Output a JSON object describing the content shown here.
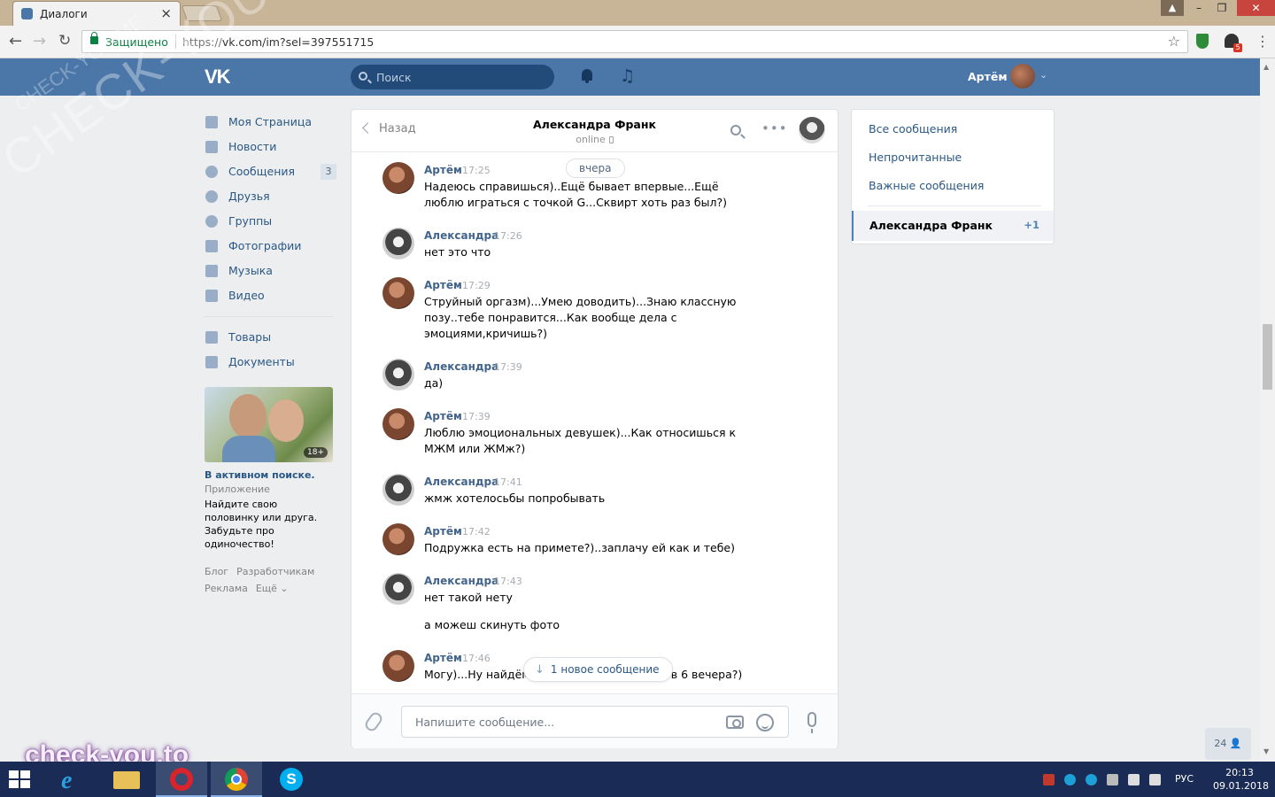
{
  "browser": {
    "tab_title": "Диалоги",
    "tab_close": "×",
    "secure_label": "Защищено",
    "url_scheme": "https://",
    "url_rest": "vk.com/im?sel=397551715",
    "extension_badge": "5",
    "window_user_glyph": "▲"
  },
  "header": {
    "logo": "VK",
    "search_placeholder": "Поиск",
    "user_name": "Артём"
  },
  "sidebar": {
    "items": [
      {
        "label": "Моя Страница",
        "icon": "home-icon"
      },
      {
        "label": "Новости",
        "icon": "news-icon"
      },
      {
        "label": "Сообщения",
        "icon": "messages-icon",
        "count": "3"
      },
      {
        "label": "Друзья",
        "icon": "friends-icon"
      },
      {
        "label": "Группы",
        "icon": "groups-icon"
      },
      {
        "label": "Фотографии",
        "icon": "photos-icon"
      },
      {
        "label": "Музыка",
        "icon": "music-icon"
      },
      {
        "label": "Видео",
        "icon": "video-icon"
      },
      {
        "label": "Товары",
        "icon": "market-icon"
      },
      {
        "label": "Документы",
        "icon": "documents-icon"
      }
    ],
    "ad": {
      "age": "18+",
      "title": "В активном поиске.",
      "type": "Приложение",
      "text": "Найдите свою половинку или друга. Забудьте про одиночество!"
    },
    "footer": {
      "blog": "Блог",
      "devs": "Разработчикам",
      "ads": "Реклама",
      "more": "Ещё ⌄"
    }
  },
  "chat": {
    "back_label": "Назад",
    "peer_name": "Александра Франк",
    "peer_status": "online",
    "date_divider": "вчера",
    "new_messages": "1 новое сообщение",
    "composer_placeholder": "Напишите сообщение...",
    "messages": [
      {
        "author": "Артём",
        "time": "17:25",
        "text": "Надеюсь справишься)..Ещё бывает впервые...Ещё люблю играться с точкой G...Сквирт хоть раз был?)"
      },
      {
        "author": "Александра",
        "time": "17:26",
        "text": "нет это что"
      },
      {
        "author": "Артём",
        "time": "17:29",
        "text": "Струйный оргазм)...Умею доводить)...Знаю классную позу..тебе понравится...Как вообще дела с эмоциями,кричишь?)"
      },
      {
        "author": "Александра",
        "time": "17:39",
        "text": "да)"
      },
      {
        "author": "Артём",
        "time": "17:39",
        "text": "Люблю эмоциональных девушек)...Как относишься к МЖМ или ЖМж?)"
      },
      {
        "author": "Александра",
        "time": "17:41",
        "text": "жмж хотелосьбы попробывать"
      },
      {
        "author": "Артём",
        "time": "17:42",
        "text": "Подружка есть на примете?)..заплачу ей как и тебе)"
      },
      {
        "author": "Александра",
        "time": "17:43",
        "text": "нет такой нету"
      },
      {
        "author": "",
        "time": "",
        "text": "а можеш скинуть фото"
      },
      {
        "author": "Артём",
        "time": "17:46",
        "text": "Могу)...Ну найдём...                                    титься в среду часов в 6 вечера?)"
      }
    ]
  },
  "folders": {
    "all": "Все сообщения",
    "unread": "Непрочитанные",
    "important": "Важные сообщения",
    "active_name": "Александра Франк",
    "active_count": "+1"
  },
  "online_widget": "24",
  "watermarks": {
    "big": "CHECK-YOU.ME",
    "small": "CHECK-YOU.ME",
    "site": "check-you.to"
  },
  "taskbar": {
    "lang": "РУС",
    "time": "20:13",
    "date": "09.01.2018"
  },
  "colors": {
    "vk_blue": "#4a76a8",
    "link": "#2a5885",
    "author": "#42648b"
  }
}
